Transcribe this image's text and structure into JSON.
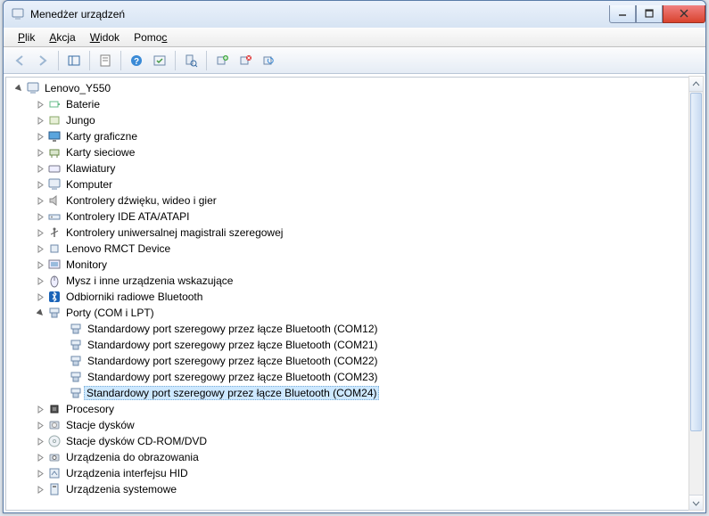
{
  "window": {
    "title": "Menedżer urządzeń"
  },
  "menu": {
    "file": "Plik",
    "action": "Akcja",
    "view": "Widok",
    "help": "Pomoc"
  },
  "root": {
    "label": "Lenovo_Y550",
    "expanded": true
  },
  "categories": [
    {
      "label": "Baterie",
      "expanded": false,
      "icon": "battery"
    },
    {
      "label": "Jungo",
      "expanded": false,
      "icon": "jungo"
    },
    {
      "label": "Karty graficzne",
      "expanded": false,
      "icon": "display"
    },
    {
      "label": "Karty sieciowe",
      "expanded": false,
      "icon": "network"
    },
    {
      "label": "Klawiatury",
      "expanded": false,
      "icon": "keyboard"
    },
    {
      "label": "Komputer",
      "expanded": false,
      "icon": "computer"
    },
    {
      "label": "Kontrolery dźwięku, wideo i gier",
      "expanded": false,
      "icon": "sound"
    },
    {
      "label": "Kontrolery IDE ATA/ATAPI",
      "expanded": false,
      "icon": "ide"
    },
    {
      "label": "Kontrolery uniwersalnej magistrali szeregowej",
      "expanded": false,
      "icon": "usb"
    },
    {
      "label": "Lenovo RMCT Device",
      "expanded": false,
      "icon": "device"
    },
    {
      "label": "Monitory",
      "expanded": false,
      "icon": "monitor"
    },
    {
      "label": "Mysz i inne urządzenia wskazujące",
      "expanded": false,
      "icon": "mouse"
    },
    {
      "label": "Odbiorniki radiowe Bluetooth",
      "expanded": false,
      "icon": "bluetooth"
    },
    {
      "label": "Porty (COM i LPT)",
      "expanded": true,
      "icon": "port",
      "children": [
        {
          "label": "Standardowy port szeregowy przez łącze Bluetooth (COM12)",
          "icon": "port"
        },
        {
          "label": "Standardowy port szeregowy przez łącze Bluetooth (COM21)",
          "icon": "port"
        },
        {
          "label": "Standardowy port szeregowy przez łącze Bluetooth (COM22)",
          "icon": "port"
        },
        {
          "label": "Standardowy port szeregowy przez łącze Bluetooth (COM23)",
          "icon": "port"
        },
        {
          "label": "Standardowy port szeregowy przez łącze Bluetooth (COM24)",
          "icon": "port",
          "selected": true
        }
      ]
    },
    {
      "label": "Procesory",
      "expanded": false,
      "icon": "cpu"
    },
    {
      "label": "Stacje dysków",
      "expanded": false,
      "icon": "disk"
    },
    {
      "label": "Stacje dysków CD-ROM/DVD",
      "expanded": false,
      "icon": "cdrom"
    },
    {
      "label": "Urządzenia do obrazowania",
      "expanded": false,
      "icon": "imaging"
    },
    {
      "label": "Urządzenia interfejsu HID",
      "expanded": false,
      "icon": "hid"
    },
    {
      "label": "Urządzenia systemowe",
      "expanded": false,
      "icon": "system"
    }
  ]
}
